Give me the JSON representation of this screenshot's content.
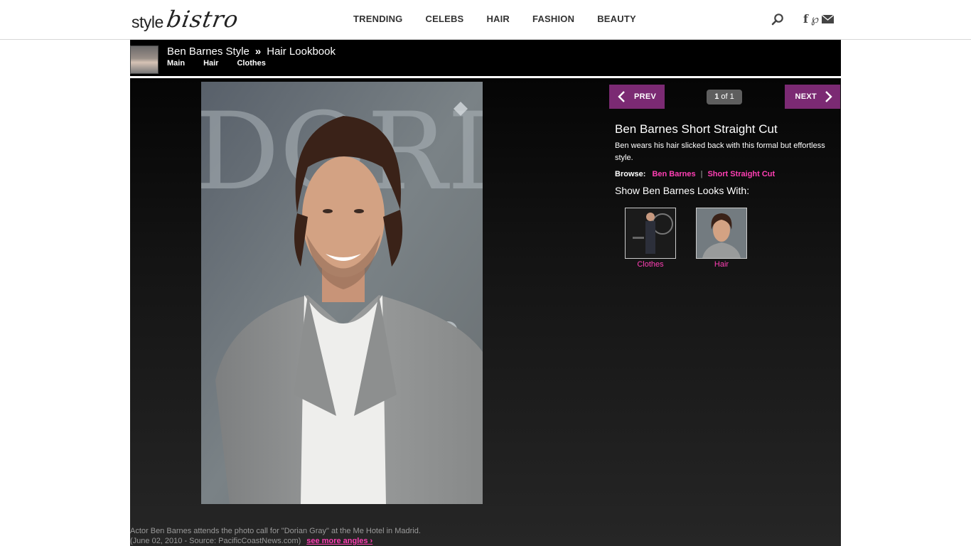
{
  "header": {
    "logo": {
      "part1": "style",
      "part2": "bistro"
    },
    "nav": [
      "TRENDING",
      "CELEBS",
      "HAIR",
      "FASHION",
      "BEAUTY"
    ],
    "icons": [
      "search-icon",
      "facebook-icon",
      "pinterest-icon",
      "mail-icon"
    ]
  },
  "breadcrumb": {
    "title": "Ben Barnes Style",
    "separator": "»",
    "section": "Hair Lookbook",
    "links": [
      "Main",
      "Hair",
      "Clothes"
    ]
  },
  "gallery": {
    "prev_label": "PREV",
    "next_label": "NEXT",
    "counter_current": "1",
    "counter_rest": " of 1"
  },
  "look": {
    "title": "Ben Barnes Short Straight Cut",
    "description": "Ben wears his hair slicked back with this formal but effortless style.",
    "browse_label": "Browse:",
    "browse_links": [
      "Ben Barnes",
      "Short Straight Cut"
    ],
    "show_label": "Show Ben Barnes Looks With:",
    "related": [
      "Clothes",
      "Hair"
    ]
  },
  "caption": {
    "line1": "Actor Ben Barnes attends the photo call for \"Dorian Gray\" at the Me Hotel in Madrid.",
    "line2": "(June 02, 2010 - Source: PacificCoastNews.com)",
    "more": "see more angles ›"
  },
  "colors": {
    "accent_purple": "#7b2a73",
    "link_pink": "#ff3fb4"
  }
}
